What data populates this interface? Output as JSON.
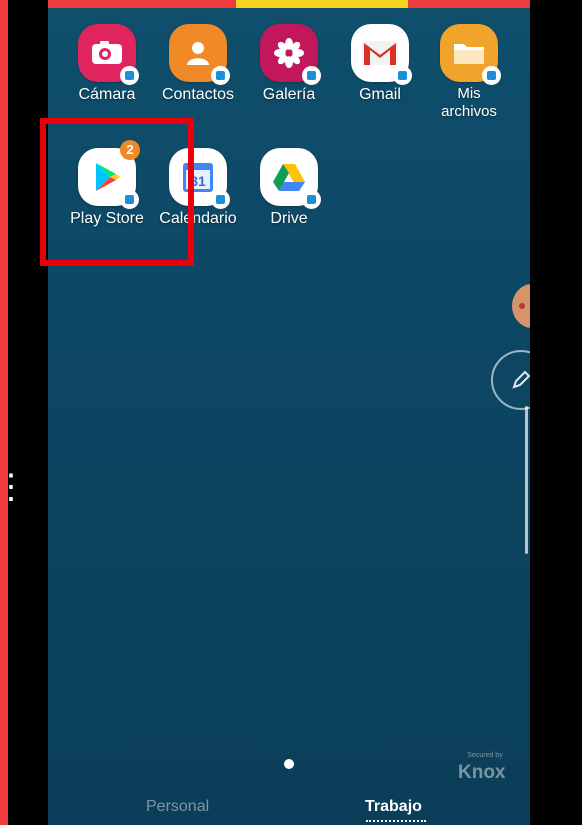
{
  "apps_row1": [
    {
      "label": "Cámara",
      "icon": "camera-icon"
    },
    {
      "label": "Contactos",
      "icon": "contacts-icon"
    },
    {
      "label": "Galería",
      "icon": "gallery-icon"
    },
    {
      "label": "Gmail",
      "icon": "gmail-icon"
    },
    {
      "label": "Mis archivos",
      "icon": "folder-icon"
    }
  ],
  "apps_row2": [
    {
      "label": "Play Store",
      "icon": "play-store-icon",
      "badge_count": "2"
    },
    {
      "label": "Calendario",
      "icon": "calendar-icon",
      "day": "31"
    },
    {
      "label": "Drive",
      "icon": "drive-icon"
    }
  ],
  "knox": {
    "secured_by": "Secured by",
    "brand": "Knox"
  },
  "tabs": {
    "personal": "Personal",
    "trabajo": "Trabajo",
    "active": "Trabajo"
  },
  "colors": {
    "frame_red": "#ef3b3b",
    "highlight_red": "#e8000b",
    "wallpaper": "#0c4663",
    "badge_orange": "#f08a26",
    "knox_blue": "#1d8fd8"
  }
}
